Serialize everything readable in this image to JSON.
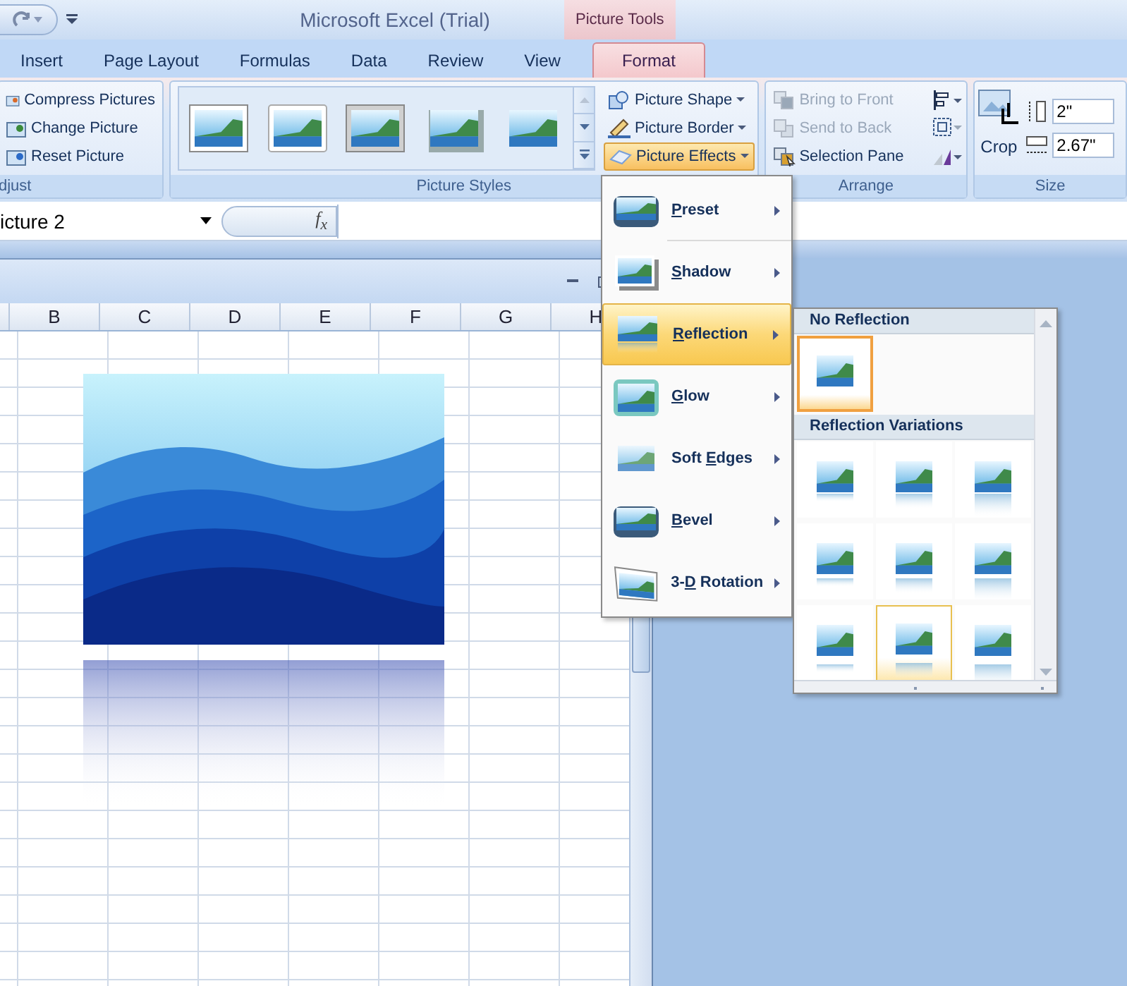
{
  "title_bar": {
    "title": "Microsoft Excel (Trial)",
    "contextual_tab": "Picture Tools"
  },
  "tabs": [
    {
      "label": "Insert",
      "selected": false
    },
    {
      "label": "Page Layout",
      "selected": false
    },
    {
      "label": "Formulas",
      "selected": false
    },
    {
      "label": "Data",
      "selected": false
    },
    {
      "label": "Review",
      "selected": false
    },
    {
      "label": "View",
      "selected": false
    },
    {
      "label": "Format",
      "selected": true
    }
  ],
  "adjust": {
    "label": "djust",
    "buttons": [
      {
        "label": "Compress Pictures",
        "kind": "compress"
      },
      {
        "label": "Change Picture",
        "kind": "change"
      },
      {
        "label": "Reset Picture",
        "kind": "reset"
      }
    ]
  },
  "picture_styles": {
    "label": "Picture Styles",
    "styles": [
      {
        "kind": "frame"
      },
      {
        "kind": "white"
      },
      {
        "kind": "thick"
      },
      {
        "kind": "shadow"
      },
      {
        "kind": "soft"
      }
    ],
    "buttons": [
      {
        "label": "Picture Shape",
        "kind": "shape",
        "selected": false
      },
      {
        "label": "Picture Border",
        "kind": "border",
        "selected": false
      },
      {
        "label": "Picture Effects",
        "kind": "effects",
        "selected": true
      }
    ]
  },
  "arrange": {
    "label": "Arrange",
    "buttons": [
      {
        "label": "Bring to Front",
        "kind": "front",
        "disabled": true
      },
      {
        "label": "Send to Back",
        "kind": "back",
        "disabled": true
      },
      {
        "label": "Selection Pane",
        "kind": "pane",
        "disabled": false
      }
    ]
  },
  "size": {
    "label": "Size",
    "crop": "Crop",
    "height": "2\"",
    "width": "2.67\""
  },
  "formula_bar": {
    "name_box": "icture 2",
    "function_symbol": "f$_{x}$"
  },
  "sheet": {
    "columns": [
      "B",
      "C",
      "D",
      "E",
      "F",
      "G",
      "H"
    ]
  },
  "effects_menu": {
    "items": [
      {
        "key": "P",
        "rest": "reset",
        "kind": "preset",
        "selected": false
      },
      {
        "key": "S",
        "rest": "hadow",
        "kind": "shadow",
        "selected": false
      },
      {
        "key": "R",
        "rest": "eflection",
        "kind": "reflection",
        "selected": true
      },
      {
        "key": "G",
        "rest": "low",
        "kind": "glow",
        "selected": false
      },
      {
        "start": "Soft ",
        "key": "E",
        "rest": "dges",
        "kind": "soft",
        "selected": false
      },
      {
        "key": "B",
        "rest": "evel",
        "kind": "bevel",
        "selected": false
      },
      {
        "start": "3-",
        "key": "D",
        "rest": " Rotation",
        "kind": "rotation",
        "selected": false
      }
    ]
  },
  "reflection_submenu": {
    "sections": [
      {
        "heading": "No Reflection",
        "options": [
          {
            "kind": "none",
            "selected": true,
            "hovered": false
          }
        ]
      },
      {
        "heading": "Reflection Variations",
        "options": [
          {
            "kind": "tight1",
            "selected": false,
            "hovered": false
          },
          {
            "kind": "half1",
            "selected": false,
            "hovered": false
          },
          {
            "kind": "full1",
            "selected": false,
            "hovered": false
          },
          {
            "kind": "tight2",
            "selected": false,
            "hovered": false
          },
          {
            "kind": "half2",
            "selected": false,
            "hovered": false
          },
          {
            "kind": "full2",
            "selected": false,
            "hovered": false
          },
          {
            "kind": "tight3",
            "selected": false,
            "hovered": false
          },
          {
            "kind": "half3",
            "selected": false,
            "hovered": true
          },
          {
            "kind": "full3",
            "selected": false,
            "hovered": false
          }
        ]
      }
    ]
  }
}
